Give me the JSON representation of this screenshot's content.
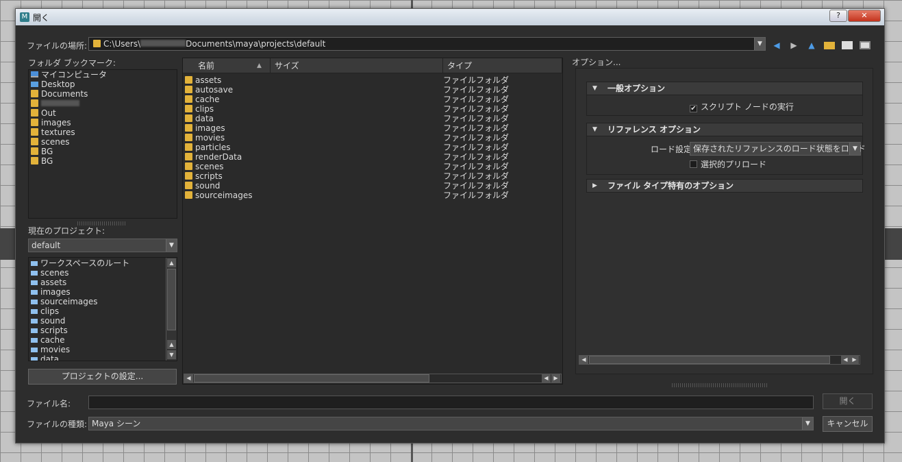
{
  "window": {
    "title": "開く",
    "help": "?",
    "close": "✕"
  },
  "location": {
    "label": "ファイルの場所:",
    "path_prefix": "C:\\Users\\",
    "path_suffix": "Documents\\maya\\projects\\default"
  },
  "bookmarks": {
    "label": "フォルダ ブックマーク:",
    "items": [
      "マイコンピュータ",
      "Desktop",
      "Documents",
      "",
      "Out",
      "images",
      "textures",
      "scenes",
      "BG",
      "BG"
    ]
  },
  "project": {
    "label": "現在のプロジェクト:",
    "value": "default",
    "items": [
      "ワークスペースのルート",
      "scenes",
      "assets",
      "images",
      "sourceimages",
      "clips",
      "sound",
      "scripts",
      "cache",
      "movies",
      "data"
    ],
    "settings_button": "プロジェクトの設定..."
  },
  "file_list": {
    "columns": {
      "name": "名前",
      "size": "サイズ",
      "type": "タイプ"
    },
    "sort_indicator": "▲",
    "type_value": "ファイルフォルダ",
    "items": [
      "assets",
      "autosave",
      "cache",
      "clips",
      "data",
      "images",
      "movies",
      "particles",
      "renderData",
      "scenes",
      "scripts",
      "sound",
      "sourceimages"
    ]
  },
  "options": {
    "title": "オプション...",
    "general": {
      "label": "一般オプション",
      "script_node": "スクリプト ノードの実行",
      "script_node_checked": true
    },
    "reference": {
      "label": "リファレンス オプション",
      "load_label": "ロード設定",
      "load_value": "保存されたリファレンスのロード状態をロード",
      "preload": "選択的プリロード",
      "preload_checked": false
    },
    "filetype": {
      "label": "ファイル タイプ特有のオプション"
    }
  },
  "filename": {
    "label": "ファイル名:",
    "value": ""
  },
  "filetype": {
    "label": "ファイルの種類:",
    "value": "Maya シーン"
  },
  "buttons": {
    "open": "開く",
    "cancel": "キャンセル"
  }
}
